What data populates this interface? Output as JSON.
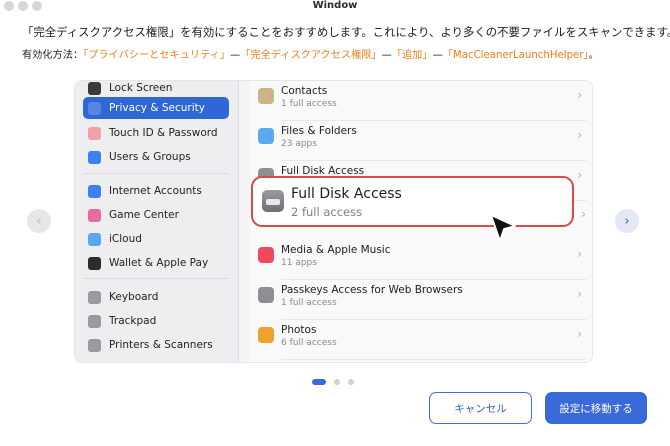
{
  "window": {
    "title": "Window"
  },
  "intro": {
    "text": "「完全ディスクアクセス権限」を有効にすることをおすすめします。これにより、より多くの不要ファイルをスキャンできます。",
    "steps_label": "有効化方法：",
    "steps": [
      "「プライバシーとセキュリティ」",
      "「完全ディスクアクセス権限」",
      "「追加」",
      "「MacCleanerLaunchHelper」"
    ],
    "separator": "—",
    "end": "。"
  },
  "sidebar": {
    "items": [
      {
        "label": "Lock Screen",
        "icon": "lock-screen-icon",
        "color": "#3a3a3c"
      },
      {
        "label": "Privacy & Security",
        "icon": "hand-icon",
        "color": "#2f67d6",
        "active": true
      },
      {
        "label": "Touch ID & Password",
        "icon": "fingerprint-icon",
        "color": "#f2a0a6"
      },
      {
        "label": "Users & Groups",
        "icon": "users-icon",
        "color": "#3b82f0"
      },
      {
        "label": "Internet Accounts",
        "icon": "at-icon",
        "color": "#3b82f0"
      },
      {
        "label": "Game Center",
        "icon": "game-center-icon",
        "color": "#e86aa0"
      },
      {
        "label": "iCloud",
        "icon": "cloud-icon",
        "color": "#5aa8f0"
      },
      {
        "label": "Wallet & Apple Pay",
        "icon": "wallet-icon",
        "color": "#2c2c2e"
      },
      {
        "label": "Keyboard",
        "icon": "keyboard-icon",
        "color": "#9a9a9f"
      },
      {
        "label": "Trackpad",
        "icon": "trackpad-icon",
        "color": "#9a9a9f"
      },
      {
        "label": "Printers & Scanners",
        "icon": "printer-icon",
        "color": "#9a9a9f"
      }
    ]
  },
  "content": {
    "rows": [
      {
        "title": "Contacts",
        "subtitle": "1 full access",
        "icon": "contacts-icon",
        "color": "#c9b48a"
      },
      {
        "title": "Files & Folders",
        "subtitle": "23 apps",
        "icon": "folder-icon",
        "color": "#5aa8f0"
      },
      {
        "title": "Full Disk Access",
        "subtitle": "",
        "icon": "disk-icon",
        "color": "#8e8e93"
      },
      {
        "title": "Media & Apple Music",
        "subtitle": "11 apps",
        "icon": "music-icon",
        "color": "#f04a5a"
      },
      {
        "title": "Passkeys Access for Web Browsers",
        "subtitle": "1 full access",
        "icon": "passkey-icon",
        "color": "#8e8e93"
      },
      {
        "title": "Photos",
        "subtitle": "6 full access",
        "icon": "photos-icon",
        "color": "#f0a030"
      }
    ],
    "highlight": {
      "title": "Full Disk Access",
      "subtitle": "2 full access",
      "icon": "disk-icon"
    }
  },
  "pager": {
    "count": 3,
    "active": 0
  },
  "buttons": {
    "cancel": "キャンセル",
    "go": "設定に移動する"
  },
  "colors": {
    "accent": "#3a6ad9",
    "step": "#ef7d1a",
    "highlight_border": "#d94a45"
  }
}
